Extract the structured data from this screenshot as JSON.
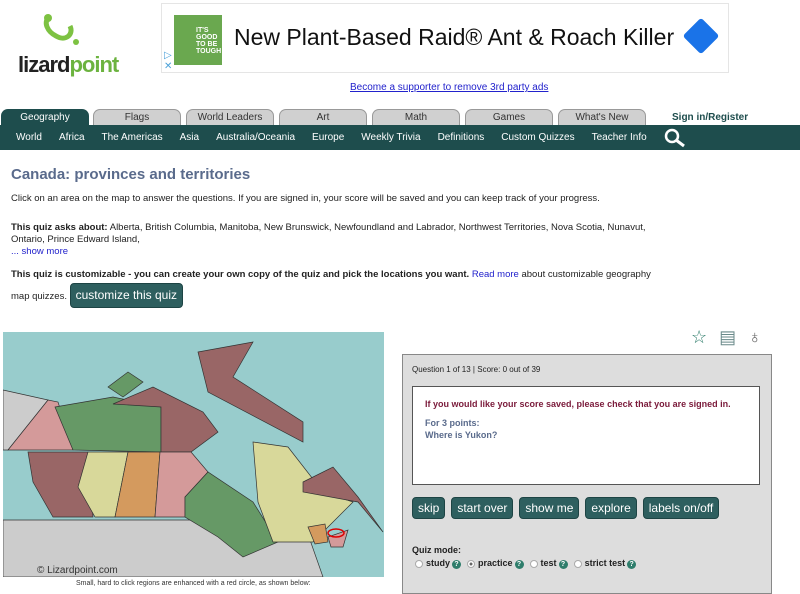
{
  "logo": {
    "text_a": "lizard",
    "text_b": "point"
  },
  "ad": {
    "product_text": "IT'S GOOD TO BE TOUGH",
    "headline": "New Plant-Based Raid® Ant & Roach Killer",
    "supporter_link": "Become a supporter to remove 3rd party ads"
  },
  "tabs": [
    {
      "label": "Geography",
      "active": true
    },
    {
      "label": "Flags"
    },
    {
      "label": "World Leaders"
    },
    {
      "label": "Art"
    },
    {
      "label": "Math"
    },
    {
      "label": "Games"
    },
    {
      "label": "What's New"
    }
  ],
  "sign_in": "Sign in/Register",
  "nav": [
    "World",
    "Africa",
    "The Americas",
    "Asia",
    "Australia/Oceania",
    "Europe",
    "Weekly Trivia",
    "Definitions",
    "Custom Quizzes",
    "Teacher Info"
  ],
  "page": {
    "title": "Canada: provinces and territories",
    "intro": "Click on an area on the map to answer the questions. If you are signed in, your score will be saved and you can keep track of your progress.",
    "asks_label": "This quiz asks about:",
    "asks_list": "Alberta, British Columbia, Manitoba, New Brunswick, Newfoundland and Labrador, Northwest Territories, Nova Scotia, Nunavut, Ontario, Prince Edward Island,",
    "show_more": "... show more",
    "custom_bold": "This quiz is customizable - you can create your own copy of the quiz and pick the locations you want.",
    "read_more": "Read more",
    "custom_rest": "about customizable geography map quizzes.",
    "customize_button": "customize this quiz"
  },
  "map": {
    "copyright": "© Lizardpoint.com",
    "caption": "Small, hard to click regions are enhanced with a red circle, as shown below:"
  },
  "icons": [
    "star-icon",
    "document-icon",
    "lightbulb-icon"
  ],
  "quiz": {
    "status": "Question 1 of 13 | Score: 0 out of 39",
    "warning": "If you would like your score saved, please check that you are signed in.",
    "points": "For 3 points:",
    "question": "Where is Yukon?",
    "buttons": [
      "skip",
      "start over",
      "show me",
      "explore",
      "labels on/off"
    ],
    "mode_label": "Quiz mode:",
    "modes": [
      {
        "label": "study",
        "selected": false
      },
      {
        "label": "practice",
        "selected": true
      },
      {
        "label": "test",
        "selected": false
      },
      {
        "label": "strict test",
        "selected": false
      }
    ]
  },
  "colors": {
    "nav": "#1e4d4d",
    "button": "#2e5f5f",
    "title": "#5a6b8c",
    "warning": "#7a1a3a"
  }
}
